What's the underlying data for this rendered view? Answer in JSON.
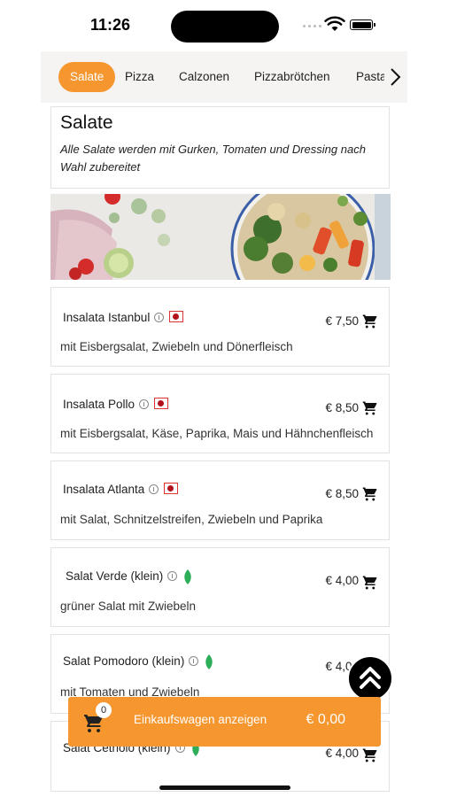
{
  "status": {
    "time": "11:26"
  },
  "tabs": [
    "Salate",
    "Pizza",
    "Calzonen",
    "Pizzabrötchen",
    "Pasta"
  ],
  "category": {
    "title": "Salate",
    "description": "Alle Salate werden mit Gurken, Tomaten und Dressing nach Wahl zubereitet"
  },
  "items": [
    {
      "name": "Insalata Istanbul",
      "badge": "flag-icon",
      "price": "€ 7,50",
      "description": "mit Eisbergsalat, Zwiebeln und Dönerfleisch"
    },
    {
      "name": "Insalata Pollo",
      "badge": "flag-icon",
      "price": "€ 8,50",
      "description": "mit Eisbergsalat, Käse, Paprika, Mais und Hähnchenfleisch"
    },
    {
      "name": "Insalata Atlanta",
      "badge": "flag-icon",
      "price": "€ 8,50",
      "description": "mit Salat, Schnitzelstreifen, Zwiebeln und Paprika"
    },
    {
      "name": "Salat Verde (klein)",
      "badge": "leaf-icon",
      "price": "€ 4,00",
      "description": "grüner Salat mit Zwiebeln"
    },
    {
      "name": "Salat Pomodoro (klein)",
      "badge": "leaf-icon",
      "price": "€ 4,00",
      "description": "mit Tomaten und Zwiebeln"
    },
    {
      "name": "Salat Cetriolo (klein)",
      "badge": "leaf-icon",
      "price": "€ 4,00",
      "description": ""
    }
  ],
  "cart": {
    "count": "0",
    "label": "Einkaufswagen anzeigen",
    "total": "€ 0,00"
  },
  "colors": {
    "accent": "#f5962e",
    "flag": "#b3121d",
    "leaf": "#2fae5a"
  }
}
